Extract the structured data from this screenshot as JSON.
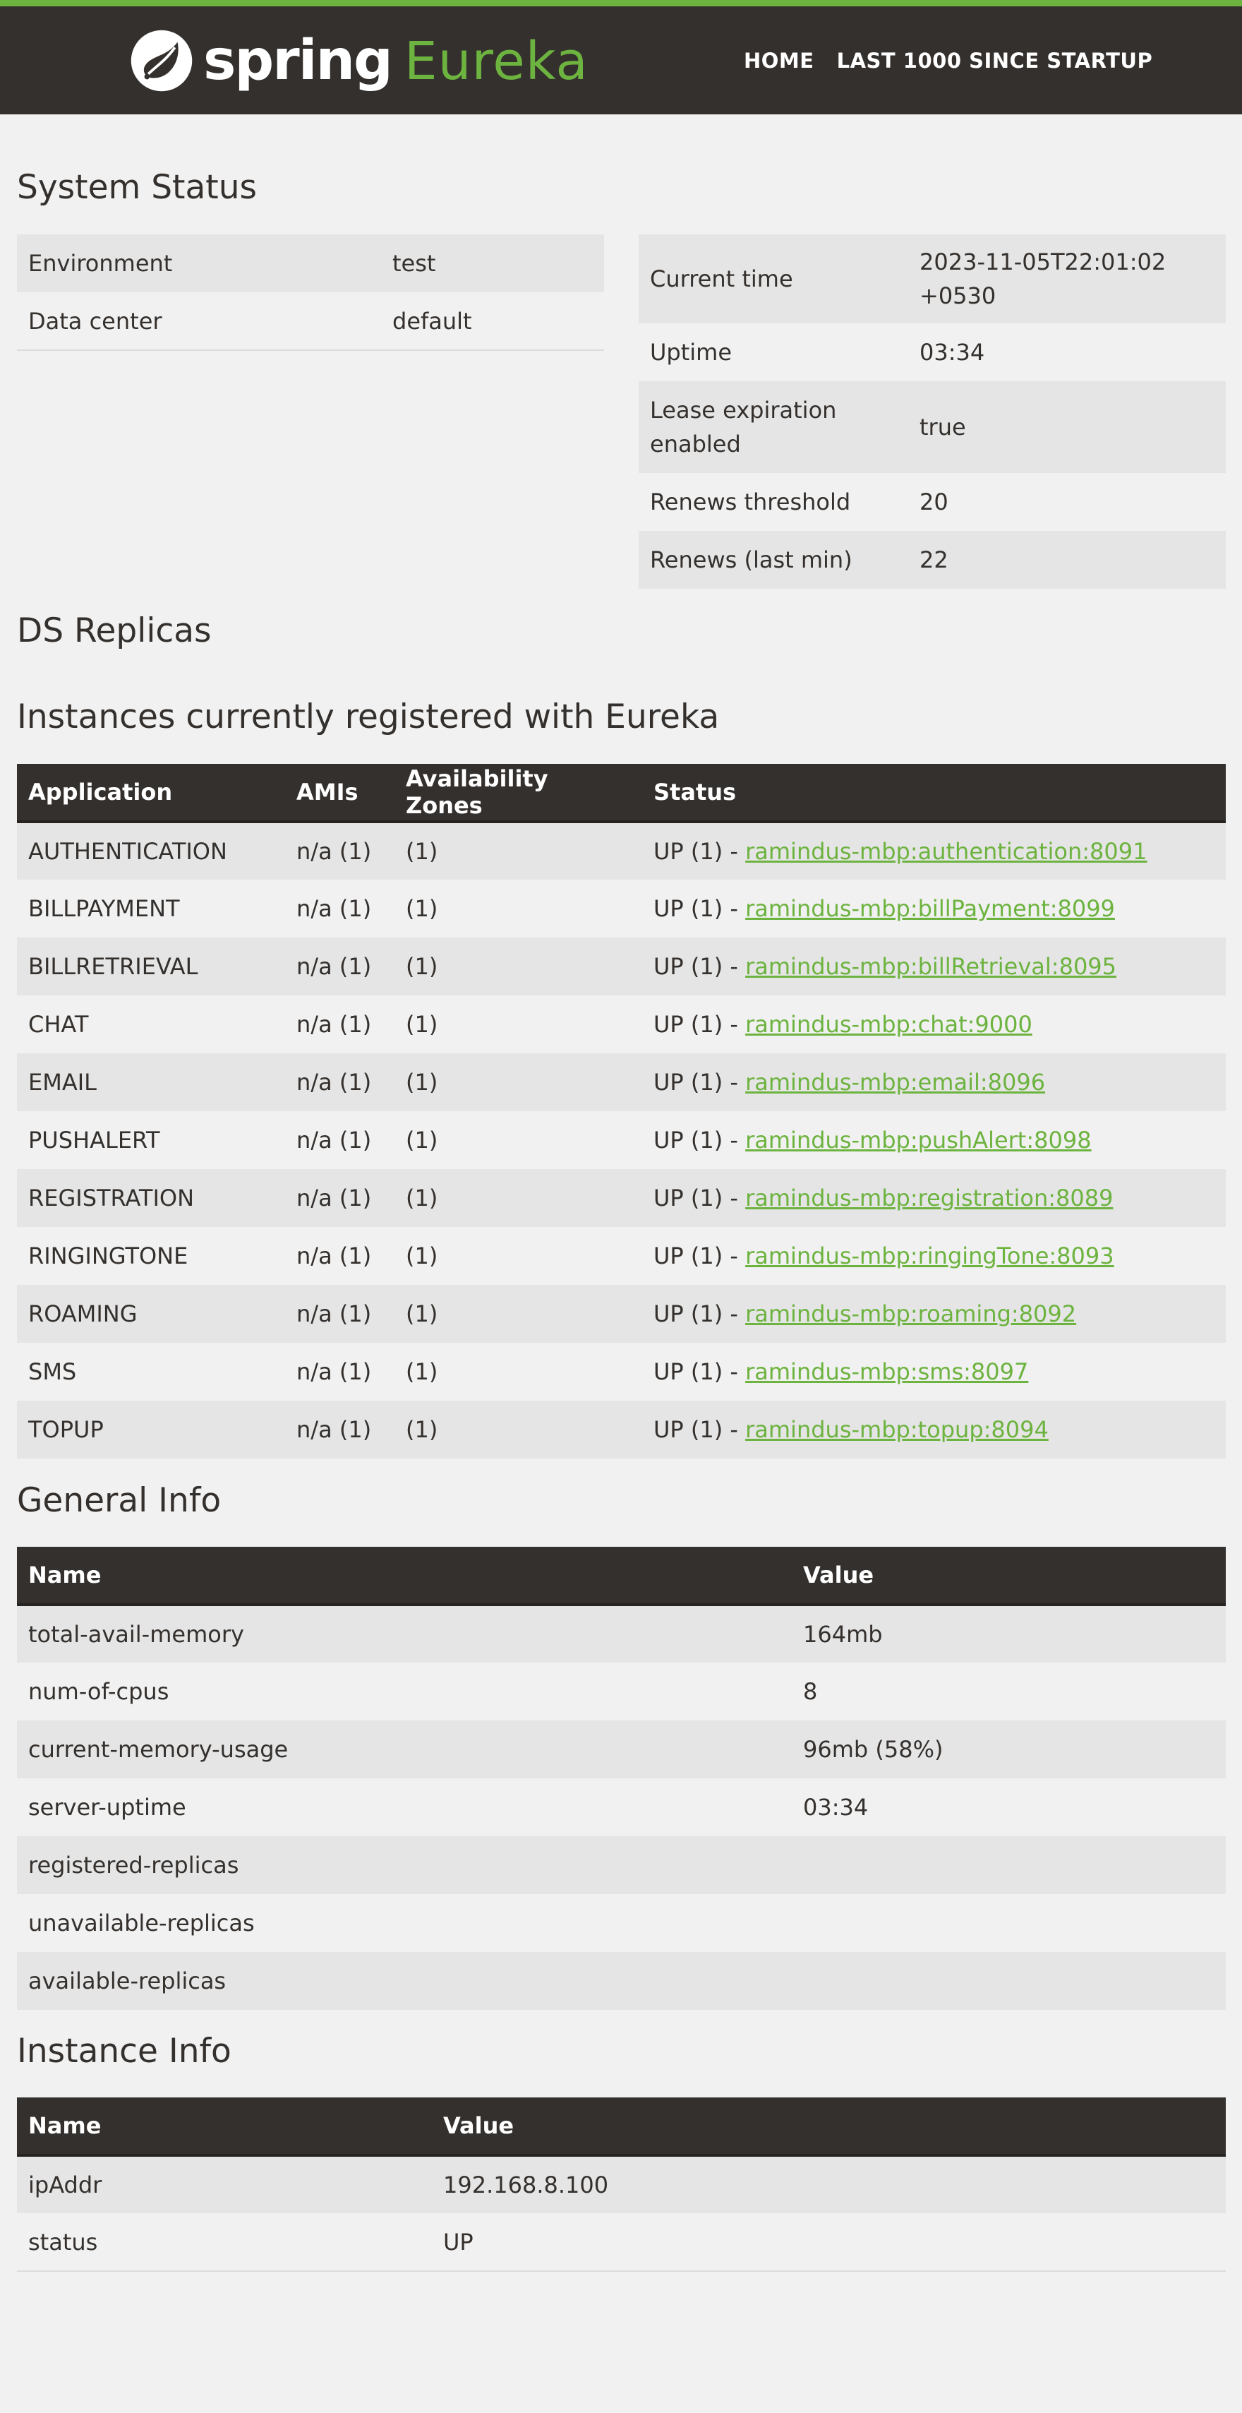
{
  "header": {
    "brand_spring": "spring",
    "brand_eureka": "Eureka",
    "nav": [
      "HOME",
      "LAST 1000 SINCE STARTUP"
    ]
  },
  "system_status": {
    "title": "System Status",
    "left": [
      {
        "label": "Environment",
        "value": "test"
      },
      {
        "label": "Data center",
        "value": "default"
      }
    ],
    "right": [
      {
        "label": "Current time",
        "value": "2023-11-05T22:01:02 +0530"
      },
      {
        "label": "Uptime",
        "value": "03:34"
      },
      {
        "label": "Lease expiration enabled",
        "value": "true"
      },
      {
        "label": "Renews threshold",
        "value": "20"
      },
      {
        "label": "Renews (last min)",
        "value": "22"
      }
    ]
  },
  "ds_replicas": {
    "title": "DS Replicas"
  },
  "instances": {
    "title": "Instances currently registered with Eureka",
    "headers": [
      "Application",
      "AMIs",
      "Availability Zones",
      "Status"
    ],
    "rows": [
      {
        "app": "AUTHENTICATION",
        "amis": "n/a (1)",
        "zones": "(1)",
        "status": "UP (1) - ",
        "link": "ramindus-mbp:authentication:8091"
      },
      {
        "app": "BILLPAYMENT",
        "amis": "n/a (1)",
        "zones": "(1)",
        "status": "UP (1) - ",
        "link": "ramindus-mbp:billPayment:8099"
      },
      {
        "app": "BILLRETRIEVAL",
        "amis": "n/a (1)",
        "zones": "(1)",
        "status": "UP (1) - ",
        "link": "ramindus-mbp:billRetrieval:8095"
      },
      {
        "app": "CHAT",
        "amis": "n/a (1)",
        "zones": "(1)",
        "status": "UP (1) - ",
        "link": "ramindus-mbp:chat:9000"
      },
      {
        "app": "EMAIL",
        "amis": "n/a (1)",
        "zones": "(1)",
        "status": "UP (1) - ",
        "link": "ramindus-mbp:email:8096"
      },
      {
        "app": "PUSHALERT",
        "amis": "n/a (1)",
        "zones": "(1)",
        "status": "UP (1) - ",
        "link": "ramindus-mbp:pushAlert:8098"
      },
      {
        "app": "REGISTRATION",
        "amis": "n/a (1)",
        "zones": "(1)",
        "status": "UP (1) - ",
        "link": "ramindus-mbp:registration:8089"
      },
      {
        "app": "RINGINGTONE",
        "amis": "n/a (1)",
        "zones": "(1)",
        "status": "UP (1) - ",
        "link": "ramindus-mbp:ringingTone:8093"
      },
      {
        "app": "ROAMING",
        "amis": "n/a (1)",
        "zones": "(1)",
        "status": "UP (1) - ",
        "link": "ramindus-mbp:roaming:8092"
      },
      {
        "app": "SMS",
        "amis": "n/a (1)",
        "zones": "(1)",
        "status": "UP (1) - ",
        "link": "ramindus-mbp:sms:8097"
      },
      {
        "app": "TOPUP",
        "amis": "n/a (1)",
        "zones": "(1)",
        "status": "UP (1) - ",
        "link": "ramindus-mbp:topup:8094"
      }
    ]
  },
  "general_info": {
    "title": "General Info",
    "headers": [
      "Name",
      "Value"
    ],
    "rows": [
      {
        "name": "total-avail-memory",
        "value": "164mb"
      },
      {
        "name": "num-of-cpus",
        "value": "8"
      },
      {
        "name": "current-memory-usage",
        "value": "96mb (58%)"
      },
      {
        "name": "server-uptime",
        "value": "03:34"
      },
      {
        "name": "registered-replicas",
        "value": ""
      },
      {
        "name": "unavailable-replicas",
        "value": ""
      },
      {
        "name": "available-replicas",
        "value": ""
      }
    ]
  },
  "instance_info": {
    "title": "Instance Info",
    "headers": [
      "Name",
      "Value"
    ],
    "rows": [
      {
        "name": "ipAddr",
        "value": "192.168.8.100"
      },
      {
        "name": "status",
        "value": "UP"
      }
    ]
  },
  "colors": {
    "accent": "#6db33f",
    "dark": "#34302d",
    "background": "#f1f1f1",
    "row_alt": "#e5e5e5"
  }
}
